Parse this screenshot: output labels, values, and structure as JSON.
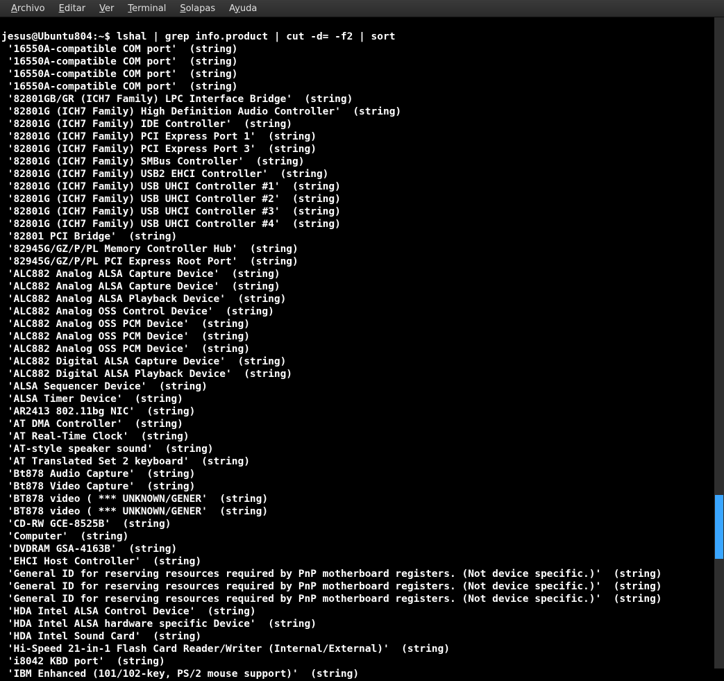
{
  "menubar": {
    "items": [
      {
        "pre": "",
        "u": "A",
        "post": "rchivo"
      },
      {
        "pre": "",
        "u": "E",
        "post": "ditar"
      },
      {
        "pre": "",
        "u": "V",
        "post": "er"
      },
      {
        "pre": "",
        "u": "T",
        "post": "erminal"
      },
      {
        "pre": "",
        "u": "S",
        "post": "olapas"
      },
      {
        "pre": "A",
        "u": "y",
        "post": "uda"
      }
    ]
  },
  "terminal": {
    "prompt": "jesus@Ubuntu804:~$ ",
    "command": "lshal | grep info.product | cut -d= -f2 | sort",
    "output": [
      " '16550A-compatible COM port'  (string)",
      " '16550A-compatible COM port'  (string)",
      " '16550A-compatible COM port'  (string)",
      " '16550A-compatible COM port'  (string)",
      " '82801GB/GR (ICH7 Family) LPC Interface Bridge'  (string)",
      " '82801G (ICH7 Family) High Definition Audio Controller'  (string)",
      " '82801G (ICH7 Family) IDE Controller'  (string)",
      " '82801G (ICH7 Family) PCI Express Port 1'  (string)",
      " '82801G (ICH7 Family) PCI Express Port 3'  (string)",
      " '82801G (ICH7 Family) SMBus Controller'  (string)",
      " '82801G (ICH7 Family) USB2 EHCI Controller'  (string)",
      " '82801G (ICH7 Family) USB UHCI Controller #1'  (string)",
      " '82801G (ICH7 Family) USB UHCI Controller #2'  (string)",
      " '82801G (ICH7 Family) USB UHCI Controller #3'  (string)",
      " '82801G (ICH7 Family) USB UHCI Controller #4'  (string)",
      " '82801 PCI Bridge'  (string)",
      " '82945G/GZ/P/PL Memory Controller Hub'  (string)",
      " '82945G/GZ/P/PL PCI Express Root Port'  (string)",
      " 'ALC882 Analog ALSA Capture Device'  (string)",
      " 'ALC882 Analog ALSA Capture Device'  (string)",
      " 'ALC882 Analog ALSA Playback Device'  (string)",
      " 'ALC882 Analog OSS Control Device'  (string)",
      " 'ALC882 Analog OSS PCM Device'  (string)",
      " 'ALC882 Analog OSS PCM Device'  (string)",
      " 'ALC882 Analog OSS PCM Device'  (string)",
      " 'ALC882 Digital ALSA Capture Device'  (string)",
      " 'ALC882 Digital ALSA Playback Device'  (string)",
      " 'ALSA Sequencer Device'  (string)",
      " 'ALSA Timer Device'  (string)",
      " 'AR2413 802.11bg NIC'  (string)",
      " 'AT DMA Controller'  (string)",
      " 'AT Real-Time Clock'  (string)",
      " 'AT-style speaker sound'  (string)",
      " 'AT Translated Set 2 keyboard'  (string)",
      " 'Bt878 Audio Capture'  (string)",
      " 'Bt878 Video Capture'  (string)",
      " 'BT878 video ( *** UNKNOWN/GENER'  (string)",
      " 'BT878 video ( *** UNKNOWN/GENER'  (string)",
      " 'CD-RW GCE-8525B'  (string)",
      " 'Computer'  (string)",
      " 'DVDRAM GSA-4163B'  (string)",
      " 'EHCI Host Controller'  (string)",
      " 'General ID for reserving resources required by PnP motherboard registers. (Not device specific.)'  (string)",
      " 'General ID for reserving resources required by PnP motherboard registers. (Not device specific.)'  (string)",
      " 'General ID for reserving resources required by PnP motherboard registers. (Not device specific.)'  (string)",
      " 'HDA Intel ALSA Control Device'  (string)",
      " 'HDA Intel ALSA hardware specific Device'  (string)",
      " 'HDA Intel Sound Card'  (string)",
      " 'Hi-Speed 21-in-1 Flash Card Reader/Writer (Internal/External)'  (string)",
      " 'i8042 KBD port'  (string)",
      " 'IBM Enhanced (101/102-key, PS/2 mouse support)'  (string)"
    ]
  }
}
